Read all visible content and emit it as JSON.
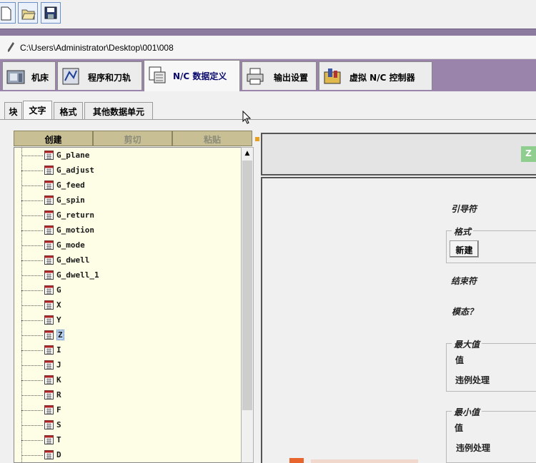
{
  "toolbar": {
    "icons": [
      "new-file-icon",
      "open-folder-icon",
      "save-disk-icon"
    ]
  },
  "path": {
    "text": "C:\\Users\\Administrator\\Desktop\\001\\008"
  },
  "main_tabs": [
    {
      "label": "机床",
      "icon": "machine-icon"
    },
    {
      "label": "程序和刀轨",
      "icon": "program-toolpath-icon"
    },
    {
      "label": "N/C 数据定义",
      "icon": "nc-data-icon"
    },
    {
      "label": "输出设置",
      "icon": "printer-icon"
    },
    {
      "label": "虚拟 N/C 控制器",
      "icon": "virtual-controller-icon"
    }
  ],
  "sub_tabs": [
    "块",
    "文字",
    "格式",
    "其他数据单元"
  ],
  "tree_buttons": {
    "create": "创建",
    "cut": "剪切",
    "paste": "粘贴"
  },
  "tree_items": [
    "G_plane",
    "G_adjust",
    "G_feed",
    "G_spin",
    "G_return",
    "G_motion",
    "G_mode",
    "G_dwell",
    "G_dwell_1",
    "G",
    "X",
    "Y",
    "Z",
    "I",
    "J",
    "K",
    "R",
    "F",
    "S",
    "T",
    "D"
  ],
  "selected_item": "Z",
  "right": {
    "badge": "Z",
    "leader_label": "引导符",
    "format_group": "格式",
    "new_button": "新建",
    "trailer_label": "结束符",
    "modal_label": "模态？",
    "max_group": "最大值",
    "max_value_label": "值",
    "max_violation_label": "违例处理",
    "min_group": "最小值",
    "min_value_label": "值",
    "min_violation_label": "违例处理"
  },
  "colors": {
    "purple_band": "#9a84ac",
    "tree_bg": "#fefee6",
    "button_olive": "#c8c094",
    "badge_green": "#8fce8f"
  }
}
